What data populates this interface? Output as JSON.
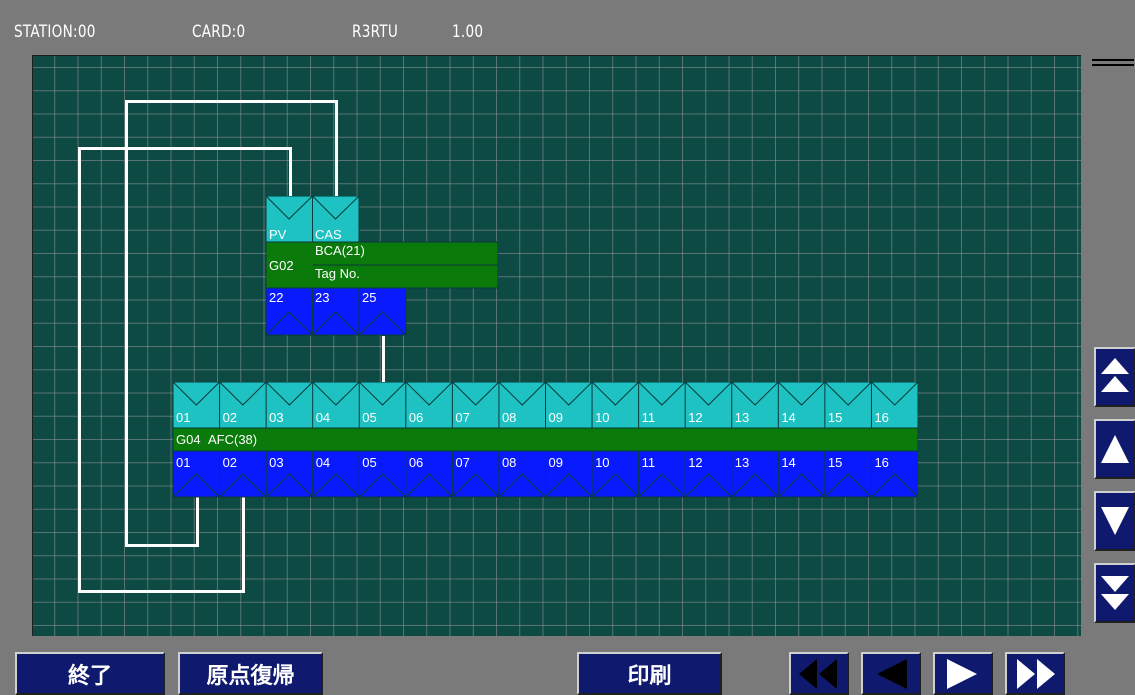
{
  "header": {
    "station": "STATION:00",
    "card": "CARD:0",
    "model": "R3RTU",
    "version": "1.00"
  },
  "block_g02": {
    "group": "G02",
    "name": "BCA(21)",
    "tag": "Tag No.",
    "inputs": [
      "PV",
      "CAS"
    ],
    "outputs": [
      "22",
      "23",
      "25"
    ]
  },
  "block_g04": {
    "group": "G04",
    "name": "AFC(38)",
    "inputs": [
      "01",
      "02",
      "03",
      "04",
      "05",
      "06",
      "07",
      "08",
      "09",
      "10",
      "11",
      "12",
      "13",
      "14",
      "15",
      "16"
    ],
    "outputs": [
      "01",
      "02",
      "03",
      "04",
      "05",
      "06",
      "07",
      "08",
      "09",
      "10",
      "11",
      "12",
      "13",
      "14",
      "15",
      "16"
    ]
  },
  "footer": {
    "exit_label": "終了",
    "home_label": "原点復帰",
    "print_label": "印刷"
  },
  "icons": {
    "first_page": "double-left-arrow",
    "prev_page": "left-triangle",
    "next_page": "right-triangle",
    "last_page": "double-right-arrow",
    "scroll_top": "double-up-arrow",
    "scroll_up": "up-triangle",
    "scroll_down": "down-triangle",
    "scroll_bottom": "double-down-arrow",
    "menu": "menu-icon"
  },
  "colors": {
    "background": "#0e4a44",
    "input_row": "#1ec2c2",
    "name_row": "#0a7a0a",
    "output_row": "#0a1aff",
    "button": "#0f1a6e",
    "wire": "#ffffff"
  }
}
